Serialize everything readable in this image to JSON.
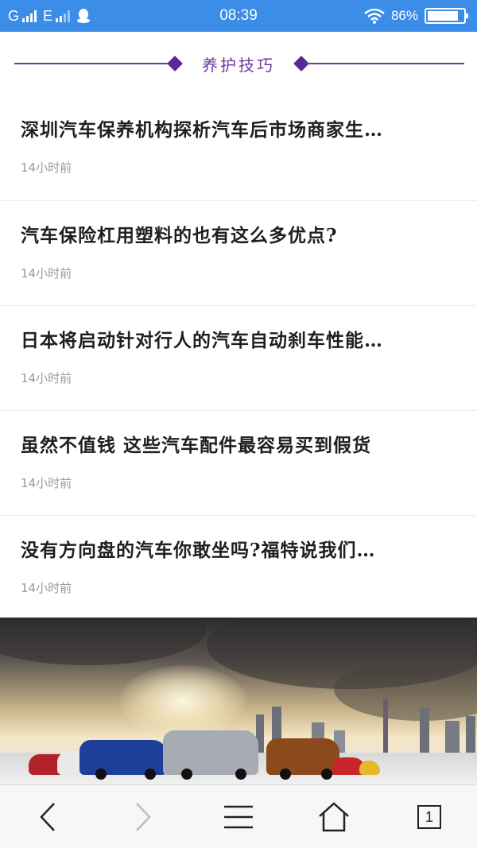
{
  "status_bar": {
    "network_1": "G",
    "network_2": "E",
    "time": "08:39",
    "battery_percent": "86%",
    "battery_level": 0.86,
    "icons": [
      "signal-icon",
      "signal-icon",
      "qq-icon",
      "wifi-icon",
      "battery-icon"
    ]
  },
  "section": {
    "title": "养护技巧"
  },
  "articles": [
    {
      "title": "深圳汽车保养机构探析汽车后市场商家生…",
      "time": "14小时前"
    },
    {
      "title": "汽车保险杠用塑料的也有这么多优点?",
      "time": "14小时前"
    },
    {
      "title": "日本将启动针对行人的汽车自动刹车性能…",
      "time": "14小时前"
    },
    {
      "title": "虽然不值钱 这些汽车配件最容易买到假货",
      "time": "14小时前"
    },
    {
      "title": "没有方向盘的汽车你敢坐吗?福特说我们…",
      "time": "14小时前"
    }
  ],
  "banner": {
    "image": "city-skyline-cars-banner"
  },
  "bottom_nav": {
    "items": [
      "back-icon",
      "forward-icon",
      "menu-icon",
      "home-icon",
      "tabs-icon"
    ],
    "tab_count": "1"
  },
  "colors": {
    "status_bar": "#3b8de8",
    "accent": "#6a3a9c",
    "title_text": "#1f1f1f",
    "time_text": "#9a9a9a"
  }
}
